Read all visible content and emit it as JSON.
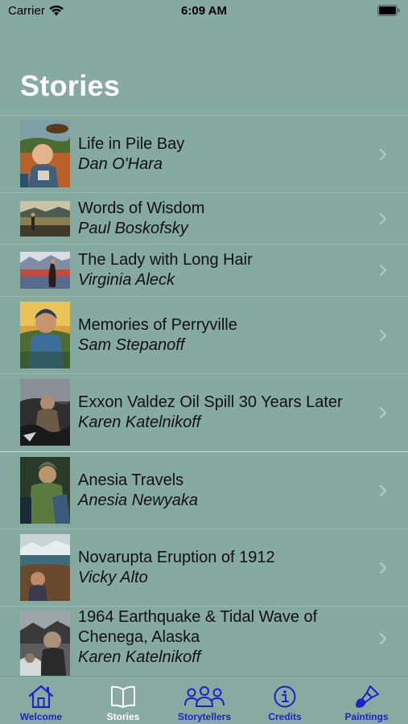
{
  "status_bar": {
    "carrier": "Carrier",
    "time": "6:09 AM"
  },
  "header": {
    "title": "Stories"
  },
  "stories": [
    {
      "title": "Life in Pile Bay",
      "title2": "",
      "author": "Dan O'Hara"
    },
    {
      "title": "Words of Wisdom",
      "title2": "",
      "author": "Paul Boskofsky"
    },
    {
      "title": "The Lady with Long Hair",
      "title2": "",
      "author": "Virginia Aleck"
    },
    {
      "title": "Memories of Perryville",
      "title2": "",
      "author": "Sam Stepanoff"
    },
    {
      "title": "Exxon Valdez Oil Spill 30 Years Later",
      "title2": "",
      "author": "Karen Katelnikoff"
    },
    {
      "title": "Anesia Travels",
      "title2": "",
      "author": "Anesia Newyaka"
    },
    {
      "title": "Novarupta Eruption of 1912",
      "title2": "",
      "author": "Vicky Alto"
    },
    {
      "title": "1964 Earthquake & Tidal Wave of",
      "title2": "Chenega, Alaska",
      "author": "Karen Katelnikoff"
    }
  ],
  "tab_bar": {
    "tabs": [
      {
        "label": "Welcome",
        "icon": "house-icon"
      },
      {
        "label": "Stories",
        "icon": "book-icon"
      },
      {
        "label": "Storytellers",
        "icon": "people-icon"
      },
      {
        "label": "Credits",
        "icon": "info-icon"
      },
      {
        "label": "Paintings",
        "icon": "paintbrush-icon"
      }
    ],
    "selected": "Stories"
  },
  "colors": {
    "background": "#86a9a0",
    "tab_tint": "#1a22c8",
    "selected_tab": "#ffffff"
  }
}
